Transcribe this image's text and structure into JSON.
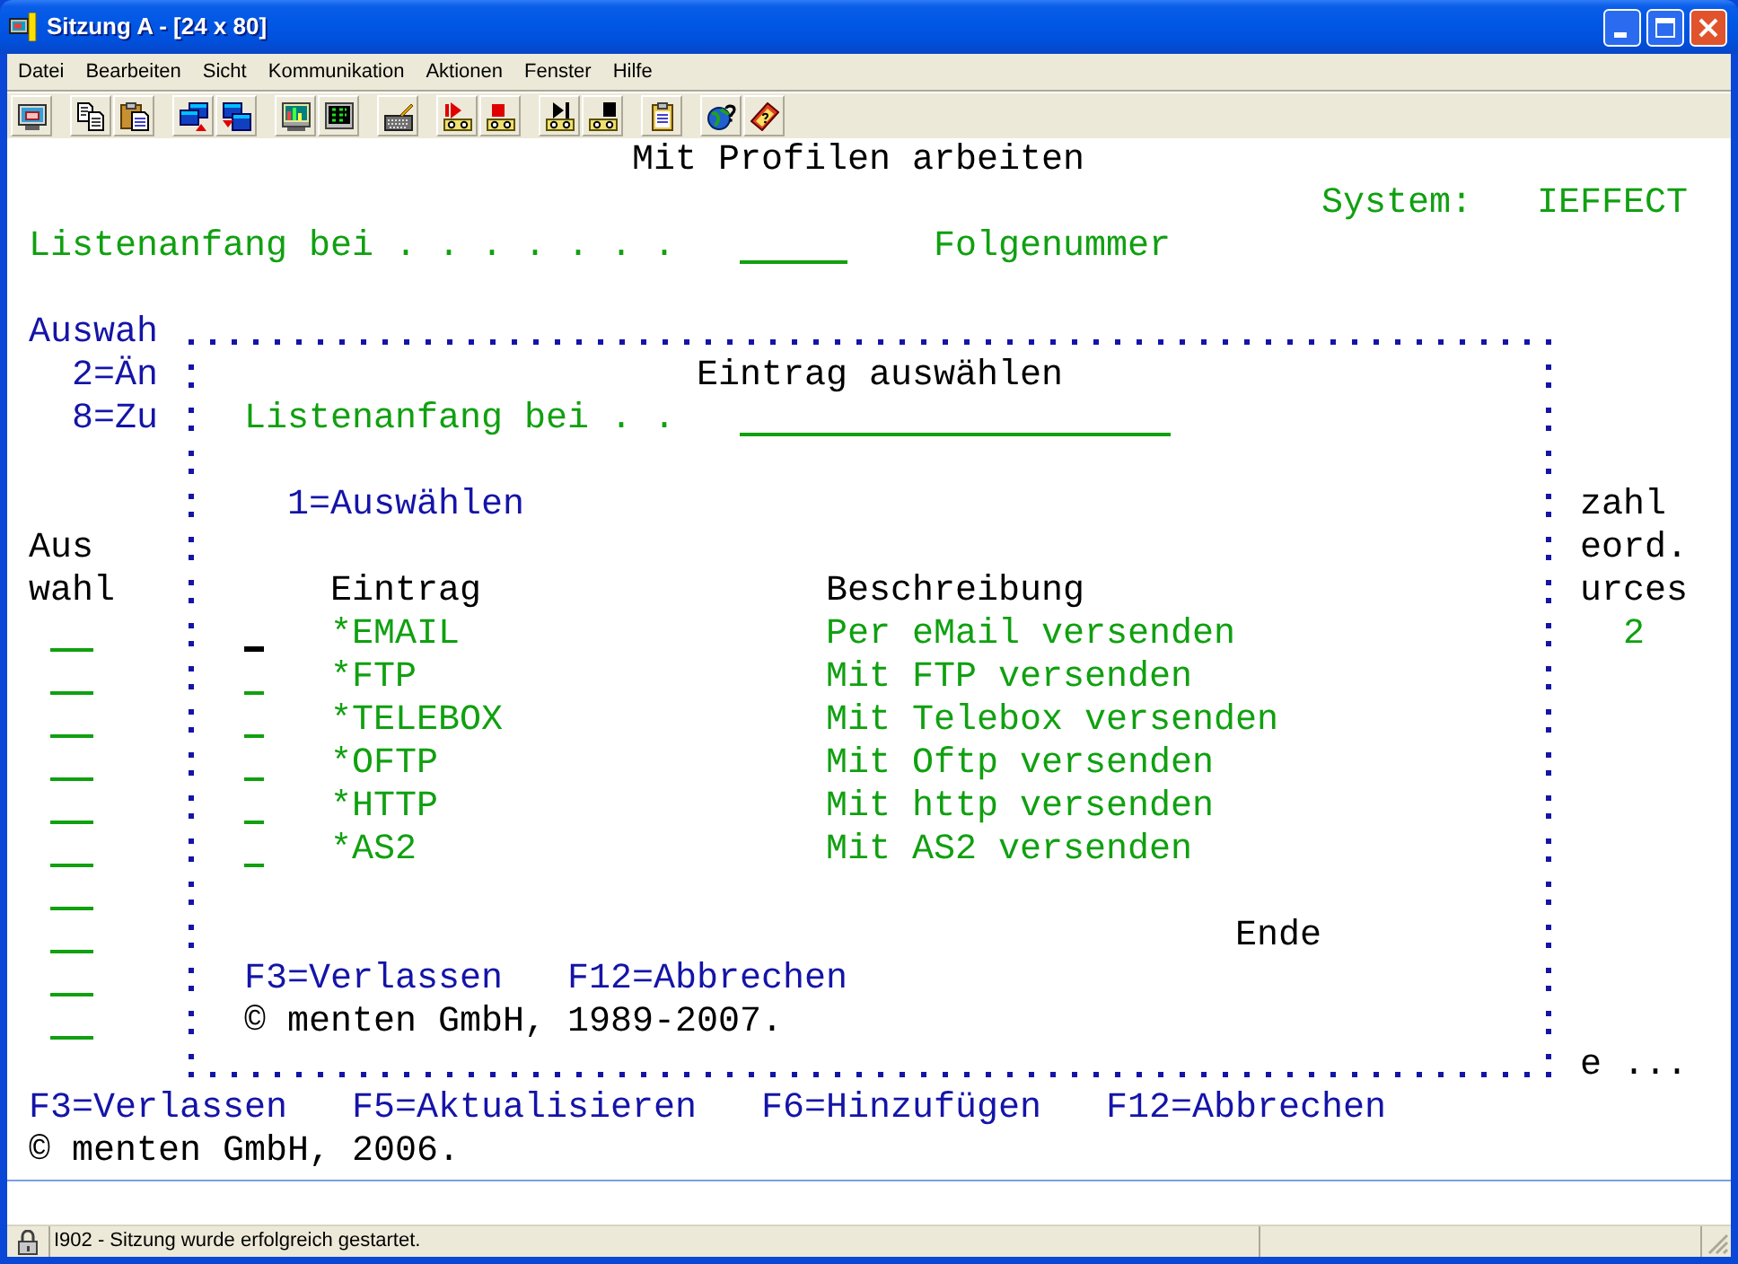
{
  "window": {
    "title": "Sitzung A - [24 x 80]"
  },
  "menu": [
    "Datei",
    "Bearbeiten",
    "Sicht",
    "Kommunikation",
    "Aktionen",
    "Fenster",
    "Hilfe"
  ],
  "screen": {
    "title": "Mit Profilen arbeiten",
    "system_label": "System:",
    "system_name": "IEFFECT",
    "start_label": "Listenanfang bei . . . . . . .",
    "sequence_label": "Folgenummer"
  },
  "list": {
    "instructions": "Auswah",
    "options": [
      "2=Än",
      "8=Zu"
    ],
    "column_headings": [
      {
        "lines": [
          "Aus",
          "wahl"
        ]
      },
      {
        "lines": [
          "zahl",
          "eord.",
          "urces"
        ]
      }
    ],
    "rows": [
      {
        "count": "2"
      }
    ],
    "more": "e ...",
    "function_keys": [
      "F3=Verlassen",
      "F5=Aktualisieren",
      "F6=Hinzufügen",
      "F12=Abbrechen"
    ],
    "copyright": "© menten GmbH, 2006."
  },
  "popup": {
    "title": "Eintrag auswählen",
    "start_label": "Listenanfang bei . .",
    "options": [
      "1=Auswählen"
    ],
    "columns": [
      "Eintrag",
      "Beschreibung"
    ],
    "rows": [
      {
        "entry": "*EMAIL",
        "description": "Per eMail versenden",
        "cursor": true
      },
      {
        "entry": "*FTP",
        "description": "Mit FTP versenden",
        "cursor": false
      },
      {
        "entry": "*TELEBOX",
        "description": "Mit Telebox versenden",
        "cursor": false
      },
      {
        "entry": "*OFTP",
        "description": "Mit Oftp versenden",
        "cursor": false
      },
      {
        "entry": "*HTTP",
        "description": "Mit http versenden",
        "cursor": false
      },
      {
        "entry": "*AS2",
        "description": "Mit AS2 versenden",
        "cursor": false
      }
    ],
    "more": "Ende",
    "function_keys": [
      "F3=Verlassen",
      "F12=Abbrechen"
    ],
    "copyright": "© menten GmbH, 1989-2007."
  },
  "status_bar": {
    "message": "I902 - Sitzung wurde erfolgreich gestartet."
  }
}
